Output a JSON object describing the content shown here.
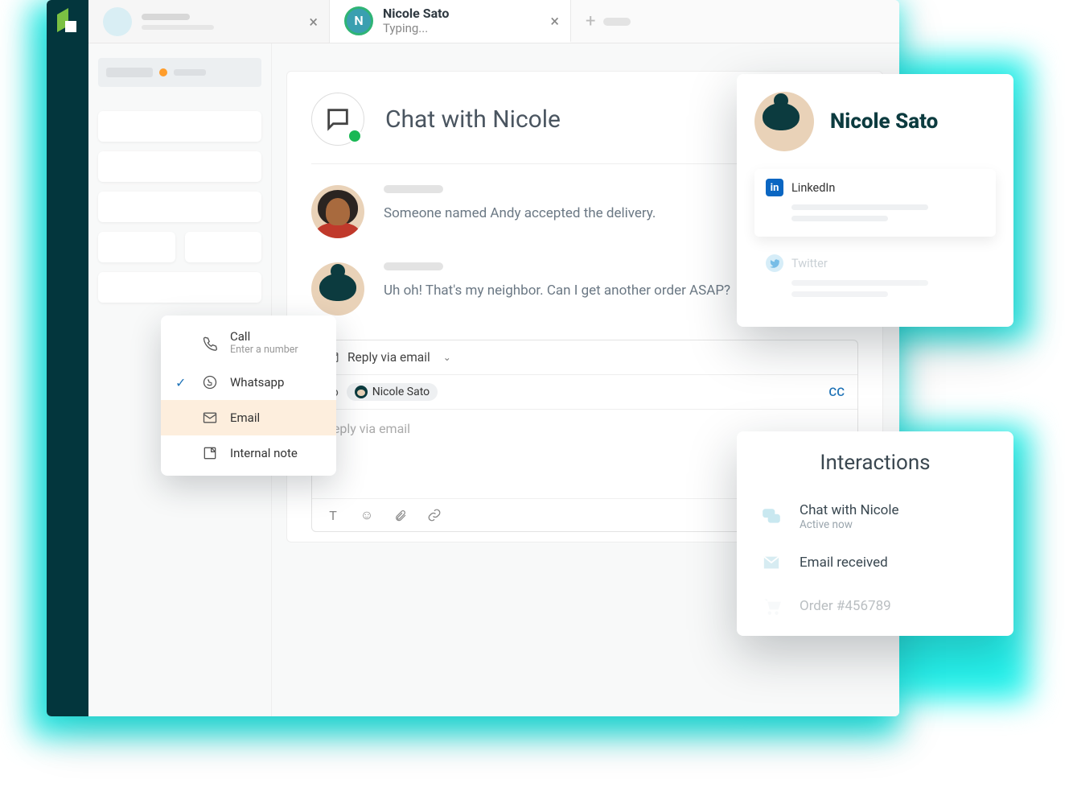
{
  "tabs": {
    "active": {
      "initial": "N",
      "name": "Nicole Sato",
      "status": "Typing..."
    }
  },
  "panel": {
    "title": "Chat with Nicole"
  },
  "messages": {
    "0": {
      "text": "Someone named Andy accepted the delivery."
    },
    "1": {
      "text": "Uh oh! That's my neighbor. Can I get another order ASAP?"
    }
  },
  "composer": {
    "mode": "Reply via email",
    "to_label": "To",
    "recipient": "Nicole Sato",
    "cc": "CC",
    "placeholder": "Reply via email"
  },
  "popup": {
    "call": {
      "label": "Call",
      "hint": "Enter a number"
    },
    "whatsapp": "Whatsapp",
    "email": "Email",
    "note": "Internal note"
  },
  "profile": {
    "name": "Nicole Sato",
    "linkedin": "LinkedIn",
    "twitter": "Twitter"
  },
  "interactions": {
    "title": "Interactions",
    "chat": {
      "title": "Chat with Nicole",
      "sub": "Active now"
    },
    "email": "Email received",
    "order": "Order #456789"
  }
}
